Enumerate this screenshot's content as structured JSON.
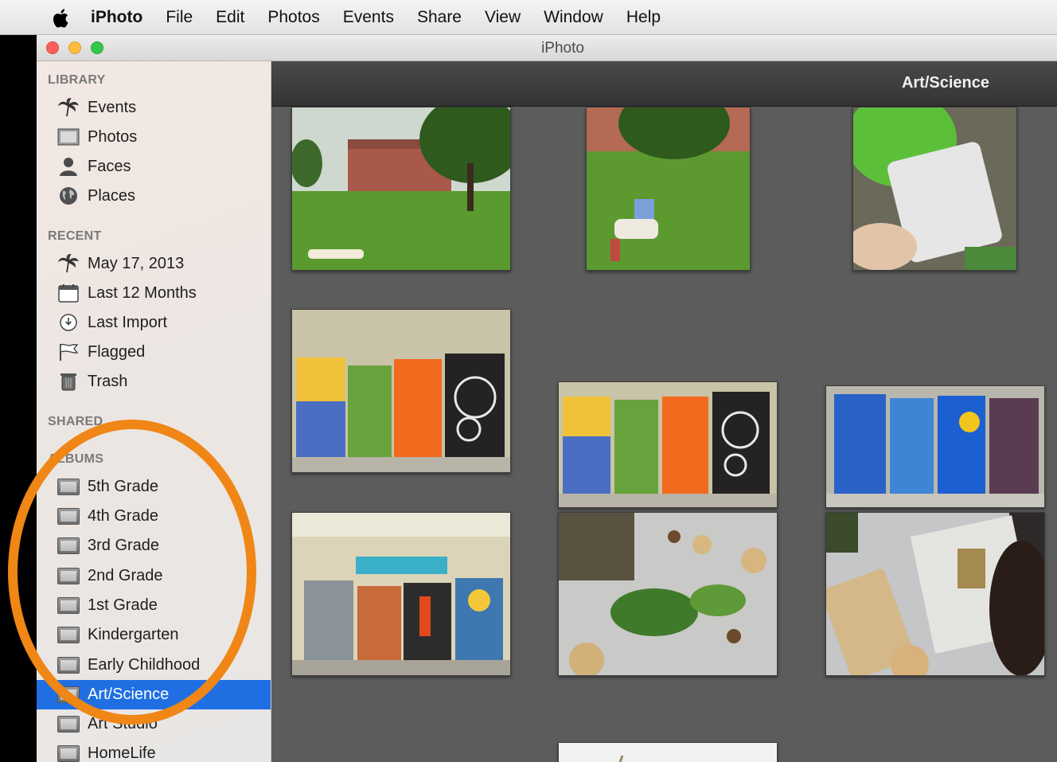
{
  "menubar": {
    "app": "iPhoto",
    "items": [
      "File",
      "Edit",
      "Photos",
      "Events",
      "Share",
      "View",
      "Window",
      "Help"
    ]
  },
  "window": {
    "title": "iPhoto"
  },
  "sidebar": {
    "library_header": "LIBRARY",
    "library": [
      "Events",
      "Photos",
      "Faces",
      "Places"
    ],
    "recent_header": "RECENT",
    "recent": [
      "May 17, 2013",
      "Last 12 Months",
      "Last Import",
      "Flagged",
      "Trash"
    ],
    "shared_header": "SHARED",
    "albums_header": "ALBUMS",
    "albums": [
      "5th Grade",
      "4th Grade",
      "3rd Grade",
      "2nd Grade",
      "1st Grade",
      "Kindergarten",
      "Early Childhood",
      "Art/Science",
      "Art Studio",
      "HomeLife"
    ],
    "selected_album": "Art/Science"
  },
  "main": {
    "title": "Art/Science"
  },
  "colors": {
    "selection": "#1f6fe3",
    "highlight_ring": "#ef8616",
    "grid_background": "#5c5c5c"
  }
}
